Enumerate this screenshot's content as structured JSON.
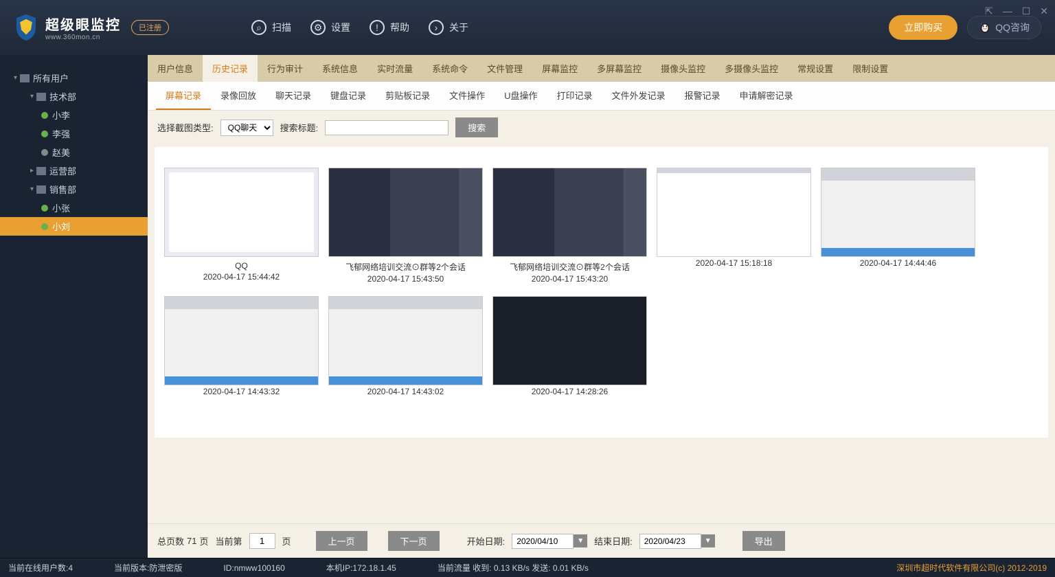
{
  "header": {
    "title": "超级眼监控",
    "subtitle": "www.360mon.cn",
    "badge": "已注册",
    "nav": {
      "scan": "扫描",
      "settings": "设置",
      "help": "帮助",
      "about": "关于"
    },
    "buy": "立即购买",
    "qq": "QQ咨询"
  },
  "sidebar": {
    "root": "所有用户",
    "groups": [
      {
        "name": "技术部",
        "users": [
          "小李",
          "李强",
          "赵美"
        ]
      },
      {
        "name": "运营部",
        "users": []
      },
      {
        "name": "销售部",
        "users": [
          "小张",
          "小刘"
        ]
      }
    ]
  },
  "tabs_main": [
    "用户信息",
    "历史记录",
    "行为审计",
    "系统信息",
    "实时流量",
    "系统命令",
    "文件管理",
    "屏幕监控",
    "多屏幕监控",
    "摄像头监控",
    "多摄像头监控",
    "常规设置",
    "限制设置"
  ],
  "tabs_main_active": 1,
  "tabs_sub": [
    "屏幕记录",
    "录像回放",
    "聊天记录",
    "键盘记录",
    "剪贴板记录",
    "文件操作",
    "U盘操作",
    "打印记录",
    "文件外发记录",
    "报警记录",
    "申请解密记录"
  ],
  "tabs_sub_active": 0,
  "filter": {
    "type_label": "选择截图类型:",
    "type_value": "QQ聊天",
    "search_label": "搜索标题:",
    "search_btn": "搜索"
  },
  "thumbs": [
    {
      "title": "QQ",
      "time": "2020-04-17 15:44:42",
      "style": "qq"
    },
    {
      "title": "飞郁网络培训交流⊙群等2个会话",
      "time": "2020-04-17 15:43:50",
      "style": "chat"
    },
    {
      "title": "飞郁网络培训交流⊙群等2个会话",
      "time": "2020-04-17 15:43:20",
      "style": "chat"
    },
    {
      "title": "",
      "time": "2020-04-17 15:18:18",
      "style": "browser"
    },
    {
      "title": "",
      "time": "2020-04-17 14:44:46",
      "style": "doc"
    },
    {
      "title": "",
      "time": "2020-04-17 14:43:32",
      "style": "doc"
    },
    {
      "title": "",
      "time": "2020-04-17 14:43:02",
      "style": "doc"
    },
    {
      "title": "",
      "time": "2020-04-17 14:28:26",
      "style": "dev"
    }
  ],
  "pagination": {
    "total_label": "总页数",
    "total": "71",
    "page_unit": "页",
    "current_label": "当前第",
    "current": "1",
    "prev": "上一页",
    "next": "下一页",
    "start_label": "开始日期:",
    "start": "2020/04/10",
    "end_label": "结束日期:",
    "end": "2020/04/23",
    "export": "导出"
  },
  "status": {
    "online": "当前在线用户数:4",
    "version": "当前版本:防泄密版",
    "id": "ID:nmww100160",
    "ip": "本机IP:172.18.1.45",
    "traffic": "当前流量 收到: 0.13 KB/s    发送: 0.01 KB/s",
    "copyright": "深圳市超时代软件有限公司(c) 2012-2019"
  }
}
